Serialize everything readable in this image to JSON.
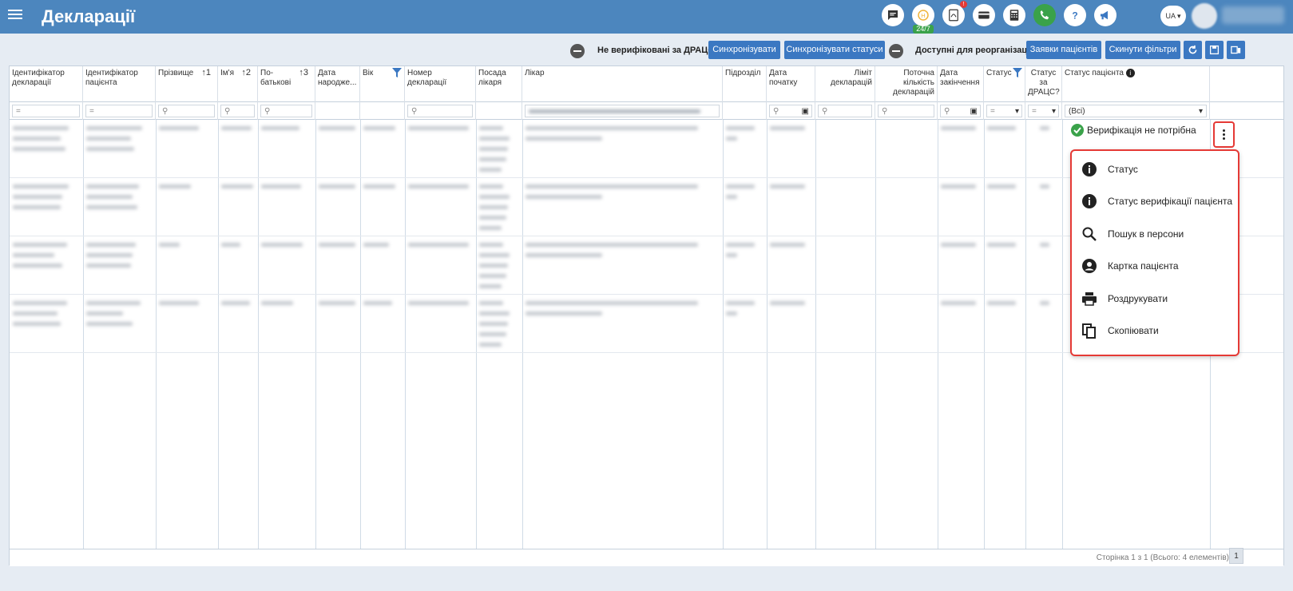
{
  "app": {
    "title": "Декларації"
  },
  "header_icons": {
    "chat_badge": "24/7",
    "alert_badge": "!",
    "language": "UA",
    "icons": [
      "chat-icon",
      "coin-icon",
      "pdf-icon",
      "card-icon",
      "calculator-icon",
      "phone-icon",
      "help-icon",
      "megaphone-icon"
    ]
  },
  "toolbar": {
    "toggle1_label": "Не верифіковані за ДРАЦС",
    "sync_label": "Синхронізувати",
    "sync_status_label": "Синхронізувати статуси",
    "toggle2_label": "Доступні для реорганізації",
    "requests_label": "Заявки пацієнтів",
    "reset_filters_label": "Скинути фільтри"
  },
  "columns": [
    {
      "label": "Ідентифікатор декларації"
    },
    {
      "label": "Ідентифікатор пацієнта"
    },
    {
      "label": "Прізвище",
      "sort": "1"
    },
    {
      "label": "Ім'я",
      "sort": "2"
    },
    {
      "label": "По-батькові",
      "sort": "3"
    },
    {
      "label": "Дата народже..."
    },
    {
      "label": "Вік"
    },
    {
      "label": "Номер декларації"
    },
    {
      "label": "Посада лікаря"
    },
    {
      "label": "Лікар"
    },
    {
      "label": "Підрозділ"
    },
    {
      "label": "Дата початку"
    },
    {
      "label": "Ліміт декларацій"
    },
    {
      "label": "Поточна кількість декларацій"
    },
    {
      "label": "Дата закінчення"
    },
    {
      "label": "Статус"
    },
    {
      "label": "Статус за ДРАЦС?"
    },
    {
      "label": "Статус пацієнта"
    }
  ],
  "filters": {
    "status_patient_value": "(Всі)",
    "eq_symbol": "="
  },
  "row_status": "Верифікація не потрібна",
  "context_menu": [
    {
      "label": "Статус",
      "icon": "info-icon"
    },
    {
      "label": "Статус верифікації пацієнта",
      "icon": "info-icon"
    },
    {
      "label": "Пошук в персони",
      "icon": "search-icon"
    },
    {
      "label": "Картка пацієнта",
      "icon": "account-circle-icon"
    },
    {
      "label": "Роздрукувати",
      "icon": "print-icon"
    },
    {
      "label": "Скопіювати",
      "icon": "copy-icon"
    }
  ],
  "footer": {
    "page_info": "Сторінка 1 з 1 (Всього: 4 елементів)",
    "page_number": "1"
  },
  "colors": {
    "topbar": "#4c86be",
    "button": "#3b78c2",
    "highlight": "#e53935",
    "ok": "#3aa24a"
  }
}
